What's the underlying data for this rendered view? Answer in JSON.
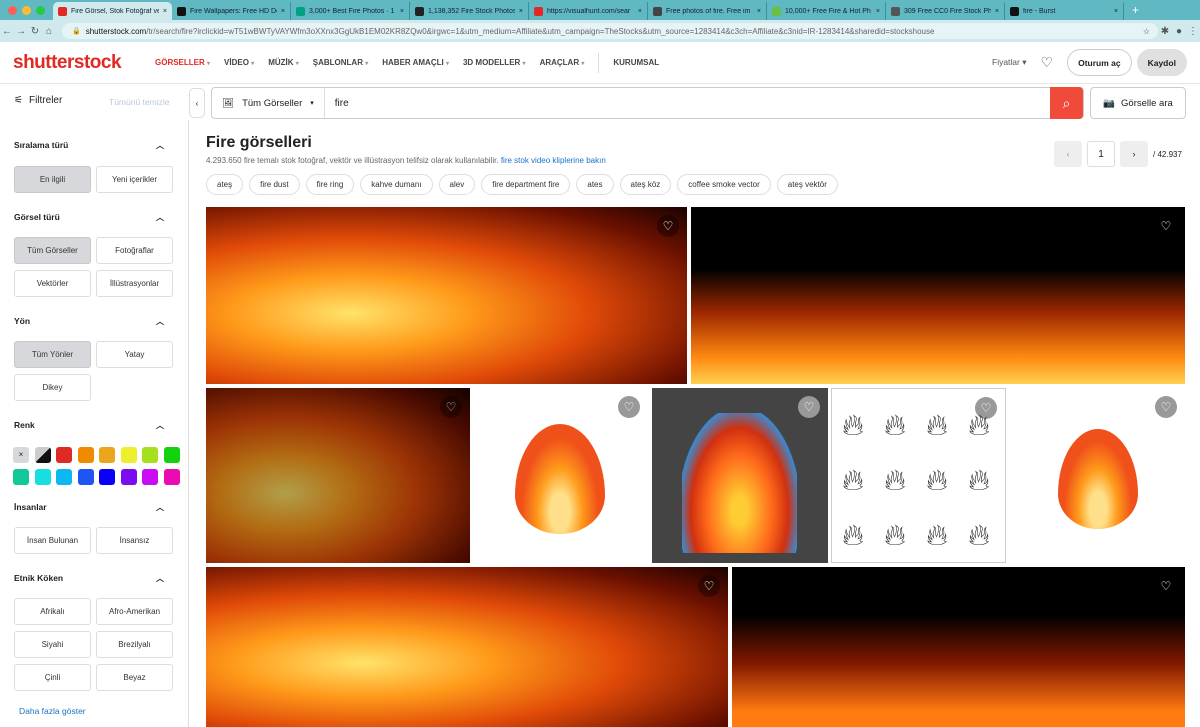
{
  "browser": {
    "tabs": [
      {
        "title": "Fire Görsel, Stok Fotoğraf ve",
        "color": "#e02b25",
        "active": true
      },
      {
        "title": "Fire Wallpapers: Free HD Do",
        "color": "#111"
      },
      {
        "title": "3,000+ Best Fire Photos · 1",
        "color": "#05a081"
      },
      {
        "title": "1,138,352 Fire Stock Photos",
        "color": "#222"
      },
      {
        "title": "https://visualhunt.com/sear",
        "color": "#e02b25"
      },
      {
        "title": "Free photos of fire. Free im",
        "color": "#444"
      },
      {
        "title": "10,000+ Free Fire & Hot Ph",
        "color": "#6cbe45"
      },
      {
        "title": "309 Free CC0 Fire Stock Ph",
        "color": "#555"
      },
      {
        "title": "fire - Burst",
        "color": "#111"
      }
    ],
    "url_domain": "shutterstock.com",
    "url_path": "/tr/search/fire?irclickid=wT51wBWTyVAYWfm3oXXnx3GgUkB1EM02KR8ZQw0&irgwc=1&utm_medium=Affiliate&utm_campaign=TheStocks&utm_source=1283414&c3ch=Affiliate&c3nid=IR-1283414&sharedid=stockshouse"
  },
  "header": {
    "logo": "shutterstock",
    "menu": [
      "GÖRSELLER",
      "VİDEO",
      "MÜZİK",
      "ŞABLONLAR",
      "HABER AMAÇLI",
      "3D MODELLER",
      "ARAÇLAR"
    ],
    "kurumsal": "KURUMSAL",
    "pricing": "Fiyatlar",
    "login": "Oturum aç",
    "signup": "Kaydol"
  },
  "search": {
    "filters": "Filtreler",
    "clear": "Tümünü temizle",
    "type": "Tüm Görseller",
    "query": "fire",
    "image_search": "Görselle ara"
  },
  "sidebar": {
    "sort": {
      "title": "Sıralama türü",
      "options": [
        "En ilgili",
        "Yeni içerikler"
      ]
    },
    "imgtype": {
      "title": "Görsel türü",
      "options": [
        "Tüm Görseller",
        "Fotoğraflar",
        "Vektörler",
        "İllüstrasyonlar"
      ]
    },
    "orient": {
      "title": "Yön",
      "options": [
        "Tüm Yönler",
        "Yatay",
        "Dikey"
      ]
    },
    "color": {
      "title": "Renk",
      "swatches": [
        "#e02b25",
        "#f08a00",
        "#eba61e",
        "#eef02e",
        "#a6e01c",
        "#14d10f",
        "#13c99a",
        "#17dedf",
        "#0bb9ee",
        "#1f55f2",
        "#0a00f5",
        "#7c0cf0",
        "#c90cf2",
        "#ea0cb2"
      ]
    },
    "people": {
      "title": "İnsanlar",
      "options": [
        "İnsan Bulunan",
        "İnsansız"
      ]
    },
    "ethnic": {
      "title": "Etnik Köken",
      "options": [
        "Afrikalı",
        "Afro-Amerikan",
        "Siyahi",
        "Brezilyalı",
        "Çinli",
        "Beyaz"
      ]
    },
    "more": "Daha fazla göster"
  },
  "main": {
    "title": "Fire görselleri",
    "subtitle": "4.293.650 fire temalı stok fotoğraf, vektör ve illüstrasyon telifsiz olarak kullanılabilir.",
    "video_link": "fire stok video kliplerine bakın",
    "page": "1",
    "total": "/ 42.937",
    "chips": [
      "ateş",
      "fire dust",
      "fire ring",
      "kahve dumanı",
      "alev",
      "fire department fire",
      "ates",
      "ateş köz",
      "coffee smoke vector",
      "ateş vektör"
    ]
  }
}
